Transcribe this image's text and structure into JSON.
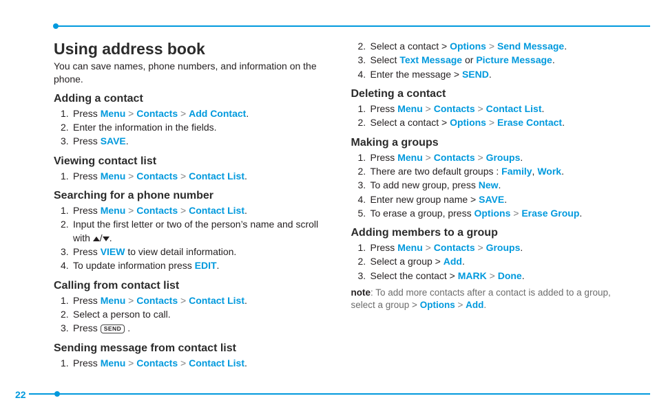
{
  "page_number": "22",
  "heading": "Using address book",
  "intro": "You can save names, phone numbers, and information on the phone.",
  "words": {
    "press": "Press",
    "menu": "Menu",
    "contacts": "Contacts",
    "add_contact": "Add Contact",
    "contact_list": "Contact List",
    "save": "SAVE",
    "view": "VIEW",
    "edit": "EDIT",
    "options": "Options",
    "send_message": "Send Message",
    "text_message": "Text Message",
    "picture_message": "Picture Message",
    "send": "SEND",
    "erase_contact": "Erase Contact",
    "groups": "Groups",
    "family": "Family",
    "work": "Work",
    "new": "New",
    "erase_group": "Erase Group",
    "add": "Add",
    "mark": "MARK",
    "done": "Done",
    "send_btn": "SEND"
  },
  "sections": {
    "adding": {
      "title": "Adding a contact",
      "s2": "Enter the information in the fields."
    },
    "viewing": {
      "title": "Viewing contact list"
    },
    "searching": {
      "title": "Searching for a phone number",
      "s2a": "Input the first letter or two of the person’s name and scroll with ",
      "s3a": " to view detail information.",
      "s4a": "To update information press "
    },
    "calling": {
      "title": "Calling from contact list",
      "s2": "Select a person to call."
    },
    "sending": {
      "title": "Sending message from contact list",
      "s2a": "Select a contact > ",
      "s3a": "Select ",
      "s3b": " or ",
      "s4a": "Enter the message > "
    },
    "deleting": {
      "title": "Deleting a contact",
      "s2a": "Select a contact > "
    },
    "mkgroups": {
      "title": "Making a groups",
      "s2a": "There are two default groups : ",
      "s3a": "To add new group, press ",
      "s4a": "Enter new group name > ",
      "s5a": "To erase a group, press "
    },
    "addmem": {
      "title": "Adding members to a group",
      "s2a": "Select a group > ",
      "s3a": "Select the contact > "
    }
  },
  "note": {
    "label": "note",
    "body": ": To add more contacts after a contact is added to a group, select a group > "
  }
}
